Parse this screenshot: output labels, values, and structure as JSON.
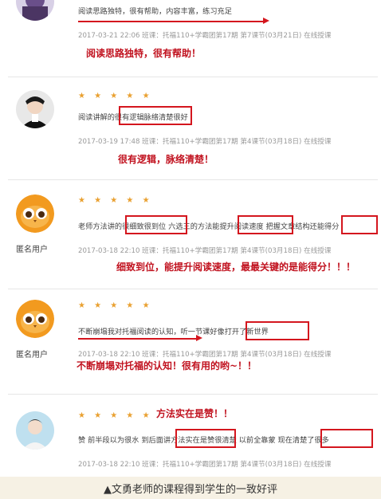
{
  "reviews": [
    {
      "user": "",
      "stars": "",
      "text": "阅读思路独特，很有帮助，内容丰富，练习充足",
      "meta": "2017-03-21 22:06   班课：托福110+学霸团第17期   第7课节(03月21日)   在线授课",
      "annotation": "阅读思路独特，很有帮助！"
    },
    {
      "user": "",
      "stars": "★ ★ ★ ★ ★",
      "text": "阅读讲解的很有逻辑脉络清楚很好",
      "meta": "2017-03-19 17:48   班课：托福110+学霸团第17期   第4课节(03月18日)   在线授课",
      "annotation": "很有逻辑，脉络清楚！"
    },
    {
      "user": "匿名用户",
      "stars": "★ ★ ★ ★ ★",
      "text": "老师方法讲的很细致很到位 六选三的方法能提升阅读速度 把握文章结构还能得分",
      "meta": "2017-03-18 22:10   班课：托福110+学霸团第17期   第4课节(03月18日)   在线授课",
      "annotation": "细致到位，能提升阅读速度，最最关键的是能得分！！！"
    },
    {
      "user": "匿名用户",
      "stars": "★ ★ ★ ★ ★",
      "text": "不断崩塌我对托福阅读的认知，听一节课好像打开了新世界",
      "meta": "2017-03-18 22:10   班课：托福110+学霸团第17期   第4课节(03月18日)   在线授课",
      "annotation": "不断崩塌对托福的认知！很有用的哟~！！"
    },
    {
      "user": "",
      "stars": "★ ★ ★ ★ ★",
      "text": "赞 前半段以为很水 到后面讲方法实在是赞很清楚 以前全靠蒙 现在清楚了很多",
      "meta": "2017-03-18 22:10   班课：托福110+学霸团第17期   第4课节(03月18日)   在线授课",
      "annotation": "方法实在是赞！！"
    }
  ],
  "caption": "▲文勇老师的课程得到学生的一致好评",
  "colors": {
    "accent_red": "#d4161e",
    "star": "#e9a030",
    "caption_bg": "#f6f1e4"
  }
}
